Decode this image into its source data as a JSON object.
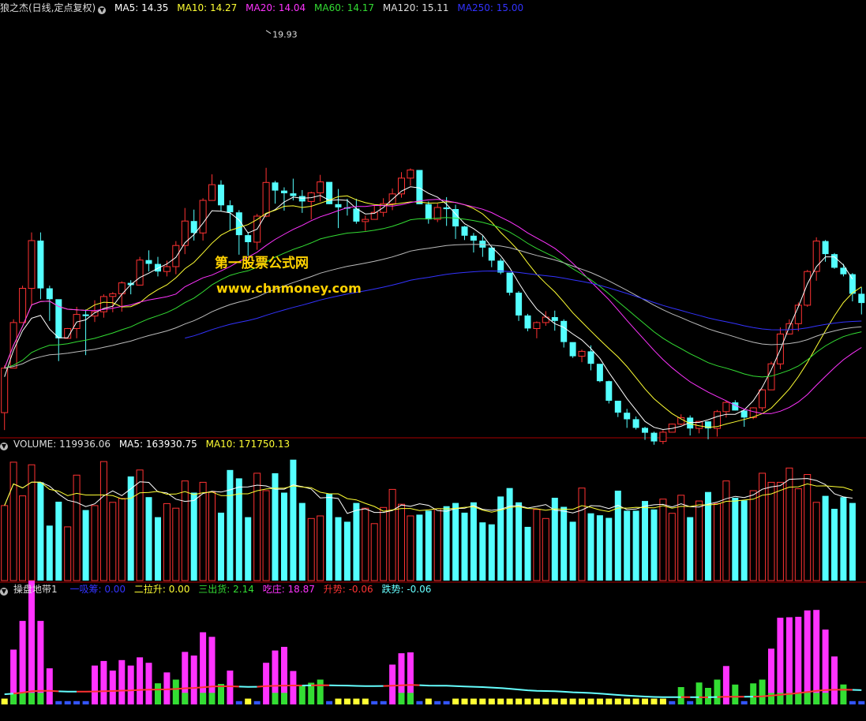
{
  "header_main": {
    "title": "狼之杰(日线,定点复权)",
    "items": [
      {
        "label": "MA5: 14.35",
        "color": "#ffffff"
      },
      {
        "label": "MA10: 14.27",
        "color": "#ffff33"
      },
      {
        "label": "MA20: 14.04",
        "color": "#ff33ff"
      },
      {
        "label": "MA60: 14.17",
        "color": "#33dd33"
      },
      {
        "label": "MA120: 15.11",
        "color": "#dddddd"
      },
      {
        "label": "MA250: 15.00",
        "color": "#3333ff"
      }
    ]
  },
  "header_volume": {
    "items": [
      {
        "label": "VOLUME: 119936.06",
        "color": "#dddddd"
      },
      {
        "label": "MA5: 163930.75",
        "color": "#ffffff"
      },
      {
        "label": "MA10: 171750.13",
        "color": "#ffff33"
      }
    ]
  },
  "header_indicator": {
    "title": "操盘地带1",
    "items": [
      {
        "label": "一吸筹: 0.00",
        "color": "#3333ff"
      },
      {
        "label": "二拉升: 0.00",
        "color": "#ffff33"
      },
      {
        "label": "三出货: 2.14",
        "color": "#33dd33"
      },
      {
        "label": "吃庄: 18.87",
        "color": "#ff33ff"
      },
      {
        "label": "升势: -0.06",
        "color": "#ff3333"
      },
      {
        "label": "跌势: -0.06",
        "color": "#66ffff"
      }
    ]
  },
  "watermark": {
    "line1": "第一股票公式网",
    "line2": "www.chnmoney.com"
  },
  "colors": {
    "background": "#000000",
    "up": "#ff3232",
    "down": "#54ffff",
    "divider": "#aa0000"
  },
  "chart_data": [
    {
      "type": "candlestick",
      "title": "狼之杰(日线,定点复权)",
      "ylim": [
        12.5,
        20.2
      ],
      "max_annotation": {
        "label": "19.93",
        "value": 19.93
      },
      "ohlc": [
        [
          12.89,
          13.76,
          13.71,
          12.57
        ],
        [
          13.71,
          14.61,
          14.55,
          13.73
        ],
        [
          14.55,
          15.23,
          15.18,
          14.76
        ],
        [
          15.18,
          16.21,
          16.06,
          14.86
        ],
        [
          16.06,
          16.21,
          15.18,
          14.98
        ],
        [
          15.18,
          15.23,
          14.98,
          14.58
        ],
        [
          14.98,
          14.94,
          14.26,
          13.84
        ],
        [
          14.26,
          14.45,
          14.44,
          14.25
        ],
        [
          14.44,
          14.84,
          14.7,
          14.26
        ],
        [
          14.7,
          14.79,
          14.67,
          13.95
        ],
        [
          14.67,
          14.96,
          14.75,
          14.56
        ],
        [
          14.75,
          15.07,
          15.03,
          14.64
        ],
        [
          15.03,
          15.11,
          15.08,
          14.74
        ],
        [
          15.08,
          15.31,
          15.28,
          14.75
        ],
        [
          15.28,
          15.33,
          15.24,
          15.07
        ],
        [
          15.24,
          15.76,
          15.7,
          15.25
        ],
        [
          15.7,
          15.88,
          15.63,
          15.49
        ],
        [
          15.63,
          15.76,
          15.49,
          15.4
        ],
        [
          15.49,
          15.69,
          15.58,
          15.4
        ],
        [
          15.58,
          16.05,
          15.97,
          15.44
        ],
        [
          15.97,
          16.66,
          16.42,
          15.81
        ],
        [
          16.42,
          16.63,
          16.2,
          16.06
        ],
        [
          16.2,
          16.84,
          16.8,
          16.06
        ],
        [
          16.8,
          17.28,
          17.09,
          16.8
        ],
        [
          17.09,
          17.17,
          16.71,
          16.6
        ],
        [
          16.71,
          16.8,
          16.58,
          16.24
        ],
        [
          16.58,
          16.62,
          16.16,
          15.8
        ],
        [
          16.16,
          16.22,
          16.03,
          15.78
        ],
        [
          16.03,
          16.55,
          16.51,
          15.89
        ],
        [
          16.51,
          17.4,
          17.13,
          16.49
        ],
        [
          17.13,
          17.16,
          16.98,
          16.74
        ],
        [
          16.98,
          17.04,
          16.93,
          16.61
        ],
        [
          16.93,
          17.2,
          16.88,
          16.8
        ],
        [
          16.88,
          16.99,
          16.78,
          16.57
        ],
        [
          16.78,
          16.96,
          16.94,
          16.45
        ],
        [
          16.94,
          17.27,
          17.14,
          16.78
        ],
        [
          17.14,
          17.13,
          16.73,
          16.73
        ],
        [
          16.73,
          17.01,
          16.67,
          16.29
        ],
        [
          16.67,
          16.83,
          16.65,
          16.52
        ],
        [
          16.65,
          16.83,
          16.41,
          16.37
        ],
        [
          16.41,
          16.52,
          16.45,
          16.24
        ],
        [
          16.45,
          16.71,
          16.58,
          16.45
        ],
        [
          16.58,
          16.84,
          16.74,
          16.5
        ],
        [
          16.74,
          17.02,
          16.92,
          16.62
        ],
        [
          16.92,
          17.32,
          17.21,
          16.85
        ],
        [
          17.21,
          17.39,
          17.36,
          17.07
        ],
        [
          17.36,
          17.33,
          16.73,
          16.73
        ],
        [
          16.73,
          16.78,
          16.45,
          16.37
        ],
        [
          16.45,
          16.74,
          16.67,
          16.4
        ],
        [
          16.67,
          16.86,
          16.64,
          16.33
        ],
        [
          16.64,
          16.72,
          16.32,
          16.09
        ],
        [
          16.32,
          16.33,
          16.15,
          16.07
        ],
        [
          16.15,
          16.2,
          16.06,
          15.84
        ],
        [
          16.06,
          16.15,
          15.93,
          15.76
        ],
        [
          15.93,
          15.96,
          15.69,
          15.57
        ],
        [
          15.69,
          15.73,
          15.47,
          15.44
        ],
        [
          15.47,
          15.45,
          15.1,
          15.05
        ],
        [
          15.1,
          15.13,
          14.68,
          14.58
        ],
        [
          14.68,
          14.71,
          14.44,
          14.39
        ],
        [
          14.44,
          14.57,
          14.55,
          14.26
        ],
        [
          14.55,
          14.76,
          14.65,
          14.49
        ],
        [
          14.65,
          14.77,
          14.58,
          14.4
        ],
        [
          14.58,
          14.61,
          14.19,
          14.09
        ],
        [
          14.19,
          14.18,
          13.93,
          13.9
        ],
        [
          13.93,
          14.05,
          14.02,
          13.82
        ],
        [
          14.02,
          14.13,
          13.79,
          13.67
        ],
        [
          13.79,
          13.73,
          13.47,
          13.45
        ],
        [
          13.47,
          13.48,
          13.11,
          13.06
        ],
        [
          13.11,
          13.1,
          12.89,
          12.81
        ],
        [
          12.89,
          12.96,
          12.77,
          12.61
        ],
        [
          12.77,
          12.82,
          12.61,
          12.58
        ],
        [
          12.61,
          12.63,
          12.52,
          12.39
        ],
        [
          12.52,
          12.54,
          12.36,
          12.3
        ],
        [
          12.36,
          12.57,
          12.53,
          12.31
        ],
        [
          12.53,
          12.69,
          12.68,
          12.55
        ],
        [
          12.68,
          12.86,
          12.8,
          12.66
        ],
        [
          12.8,
          12.84,
          12.6,
          12.47
        ],
        [
          12.6,
          12.74,
          12.73,
          12.51
        ],
        [
          12.73,
          12.73,
          12.6,
          12.4
        ],
        [
          12.6,
          12.94,
          12.91,
          12.45
        ],
        [
          12.91,
          13.11,
          13.08,
          12.8
        ],
        [
          13.08,
          13.12,
          12.93,
          12.93
        ],
        [
          12.93,
          12.96,
          12.8,
          12.63
        ],
        [
          12.8,
          12.99,
          12.98,
          12.77
        ],
        [
          12.98,
          13.33,
          13.31,
          12.92
        ],
        [
          13.31,
          13.83,
          13.79,
          13.31
        ],
        [
          13.79,
          14.46,
          14.34,
          13.69
        ],
        [
          14.34,
          14.61,
          14.53,
          14.37
        ],
        [
          14.53,
          14.92,
          14.87,
          14.39
        ],
        [
          14.87,
          15.52,
          15.49,
          14.84
        ],
        [
          15.49,
          16.12,
          16.05,
          15.32
        ],
        [
          16.05,
          16.07,
          15.81,
          15.67
        ],
        [
          15.81,
          15.83,
          15.56,
          15.54
        ],
        [
          15.56,
          15.63,
          15.44,
          15.4
        ],
        [
          15.44,
          15.46,
          15.08,
          14.94
        ],
        [
          15.08,
          15.2,
          14.91,
          14.7
        ]
      ],
      "ma5": [
        13.55,
        14.04,
        14.4,
        14.63,
        14.68,
        14.43,
        14.27,
        14.27,
        14.56,
        14.6,
        14.73,
        14.81,
        14.85,
        15.07,
        15.25,
        15.38,
        15.46,
        15.55,
        15.63,
        15.75,
        16.02,
        16.17,
        16.38,
        16.61,
        16.6,
        16.57,
        16.44,
        16.2,
        16.27,
        16.55,
        16.63,
        16.77,
        16.86,
        16.84,
        16.85,
        16.89,
        16.8,
        16.81,
        16.8,
        16.65,
        16.55,
        16.56,
        16.67,
        16.82,
        16.97,
        17.05,
        17.03,
        16.93,
        16.86,
        16.73,
        16.55,
        16.37,
        16.28,
        16.16,
        15.94,
        15.78,
        15.56,
        15.28,
        15.02,
        14.8,
        14.66,
        14.53,
        14.46,
        14.34,
        14.23,
        14.07,
        13.89,
        13.63,
        13.39,
        13.15,
        12.94,
        12.73,
        12.62,
        12.58,
        12.6,
        12.64,
        12.71,
        12.71,
        12.76,
        12.82,
        12.86,
        12.86,
        12.94,
        13.11,
        13.36,
        13.68,
        14.05,
        14.47,
        14.84,
        15.26,
        15.58,
        15.76,
        15.76,
        15.61,
        15.35
      ]
    },
    {
      "type": "bar",
      "title": "VOLUME",
      "ylim": [
        0,
        200000
      ],
      "volumes": [
        116000,
        183000,
        131000,
        179000,
        152000,
        85000,
        122000,
        83000,
        163000,
        109000,
        116000,
        184000,
        121000,
        127000,
        161000,
        171000,
        129000,
        98000,
        119000,
        112000,
        154000,
        136000,
        152000,
        137000,
        105000,
        171000,
        158000,
        98000,
        166000,
        139000,
        166000,
        136000,
        187000,
        120000,
        96000,
        100000,
        134000,
        98000,
        91000,
        120000,
        112000,
        88000,
        113000,
        141000,
        118000,
        100000,
        102000,
        108000,
        111000,
        115000,
        120000,
        105000,
        121000,
        90000,
        87000,
        130000,
        143000,
        121000,
        83000,
        110000,
        96000,
        128000,
        114000,
        91000,
        143000,
        104000,
        101000,
        97000,
        139000,
        108000,
        108000,
        123000,
        110000,
        126000,
        104000,
        132000,
        98000,
        123000,
        137000,
        119000,
        154000,
        128000,
        124000,
        139000,
        166000,
        152000,
        152000,
        174000,
        142000,
        164000,
        121000,
        131000,
        111000,
        129000,
        120000
      ],
      "ma5": [
        116000,
        149500,
        143333,
        152250,
        152200,
        146000,
        133800,
        124200,
        121000,
        114400,
        118600,
        131000,
        138600,
        131400,
        141800,
        152800,
        151800,
        137200,
        135600,
        125800,
        122400,
        123800,
        134600,
        138200,
        136800,
        140200,
        144600,
        144800,
        147600,
        146400,
        141400,
        141400,
        148000,
        145200,
        141600,
        127800,
        128600,
        126800,
        103800,
        108600,
        111000,
        105400,
        105400,
        108400,
        116800,
        114800,
        118800,
        116400,
        108200,
        107200,
        111200,
        111800,
        116000,
        110200,
        108600,
        110400,
        115000,
        116200,
        112200,
        114600,
        117600,
        108800,
        107400,
        104600,
        109000,
        115800,
        115200,
        111400,
        116400,
        109800,
        110600,
        115000,
        117200,
        117800,
        113800,
        118600,
        114200,
        113800,
        118200,
        121400,
        126600,
        130200,
        128400,
        132400,
        141200,
        144800,
        146800,
        156600,
        157200,
        157800,
        154800,
        148400,
        134200,
        129400,
        127400
      ]
    },
    {
      "type": "bar",
      "title": "操盘地带1",
      "series_names": [
        "一吸筹",
        "二拉升",
        "三出货",
        "吃庄",
        "升势",
        "跌势"
      ],
      "last_values": {
        "一吸筹": 0.0,
        "二拉升": 0.0,
        "三出货": 2.14,
        "吃庄": 18.87,
        "升势": -0.06,
        "跌势": -0.06
      }
    }
  ]
}
